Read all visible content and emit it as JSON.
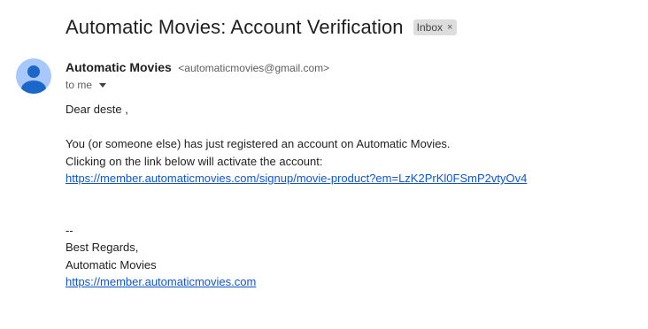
{
  "email": {
    "subject": "Automatic Movies: Account Verification",
    "label": {
      "text": "Inbox",
      "close_glyph": "×"
    },
    "sender": {
      "name": "Automatic Movies",
      "email": "<automaticmovies@gmail.com>",
      "avatar_icon": "person-icon"
    },
    "recipient": "to me",
    "recipient_dropdown_icon": "caret-down-icon",
    "body": {
      "greeting": "Dear deste ,",
      "line1": "You (or someone else) has just registered an account on Automatic Movies.",
      "line2": "Clicking on the link below will activate the account:",
      "activation_link": "https://member.automaticmovies.com/signup/movie-product?em=LzK2PrKl0FSmP2vtyOv4",
      "signature_dash": "--",
      "regards": "Best Regards,",
      "signature_name": "Automatic Movies",
      "signature_link": "https://member.automaticmovies.com"
    }
  },
  "colors": {
    "link": "#1155cc",
    "avatar_bg": "#a8c7fa",
    "avatar_fg": "#1b66c9",
    "chip_bg": "#dddddd"
  }
}
